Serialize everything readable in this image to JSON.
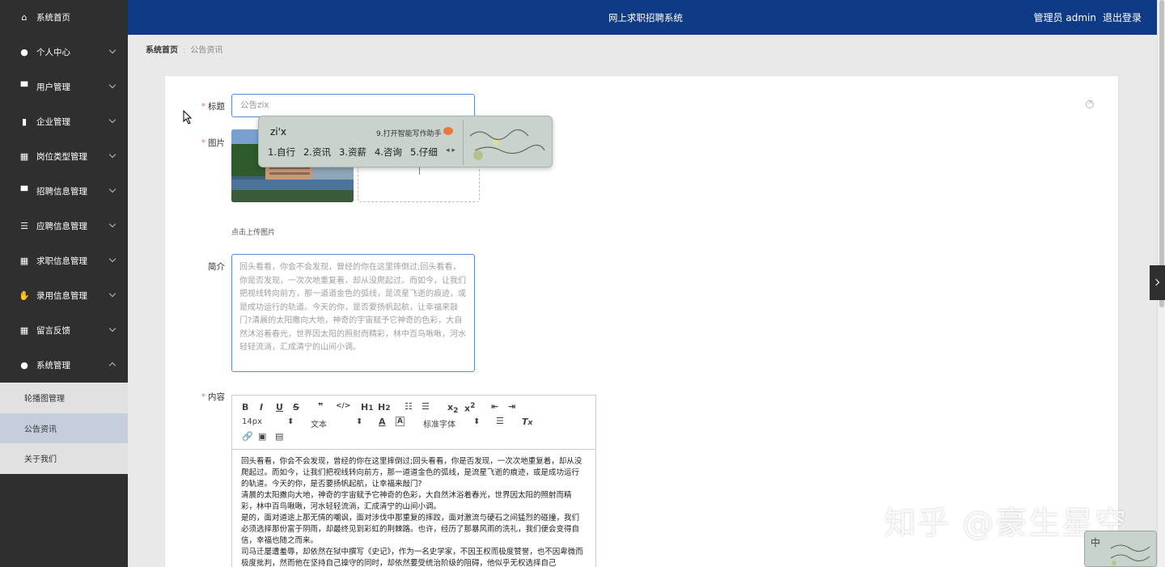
{
  "header": {
    "title": "网上求职招聘系统",
    "user": "管理员 admin",
    "logout": "退出登录"
  },
  "sidebar": {
    "items": [
      {
        "label": "系统首页",
        "icon": "home-icon",
        "has_arrow": false
      },
      {
        "label": "个人中心",
        "icon": "user-icon",
        "has_arrow": true
      },
      {
        "label": "用户管理",
        "icon": "monitor-icon",
        "has_arrow": true
      },
      {
        "label": "企业管理",
        "icon": "bar-chart-icon",
        "has_arrow": true
      },
      {
        "label": "岗位类型管理",
        "icon": "grid-icon",
        "has_arrow": true
      },
      {
        "label": "招聘信息管理",
        "icon": "monitor-icon",
        "has_arrow": true
      },
      {
        "label": "应聘信息管理",
        "icon": "sliders-icon",
        "has_arrow": true
      },
      {
        "label": "求职信息管理",
        "icon": "grid-icon",
        "has_arrow": true
      },
      {
        "label": "录用信息管理",
        "icon": "thumb-up-icon",
        "has_arrow": true
      },
      {
        "label": "留言反馈",
        "icon": "grid-icon",
        "has_arrow": true
      },
      {
        "label": "系统管理",
        "icon": "bulb-icon",
        "has_arrow": true,
        "expanded": true
      }
    ],
    "submenu": [
      {
        "label": "轮播图管理"
      },
      {
        "label": "公告资讯",
        "active": true
      },
      {
        "label": "关于我们"
      }
    ]
  },
  "breadcrumb": {
    "home": "系统首页",
    "current": "公告资讯"
  },
  "form": {
    "title_label": "标题",
    "title_value": "公告zix",
    "image_label": "图片",
    "upload_tip": "点击上传图片",
    "intro_label": "简介",
    "intro_text": "回头看看，你会不会发现，曾经的你在这里摔倒过;回头看看，你是否发现，一次次地重复着，却从没爬起过。而如今，让我们把视线转向前方，那一道道金色的弧线，是流星飞逝的痕迹，或是成功运行的轨道。今天的你，是否要扬帆起航，让幸福来敲门?清晨的太阳撒向大地，神奇的宇宙赋予它神奇的色彩，大自然沐浴着春光，世界因太阳的照射而精彩，林中百鸟啾啾，河水轻轻流淌，汇成清宁的山间小调。",
    "content_label": "内容",
    "editor": {
      "font_size": "14px",
      "block_type": "文本",
      "font_family": "标准字体",
      "content_lines": [
        "回头看看，你会不会发现，曾经的你在这里摔倒过;回头看看，你是否发现，一次次地重复着，却从没爬起过。而如今，让我们把视线转向前方，那一道道金色的弧线，是流星飞逝的痕迹，或是成功运行的轨道。今天的你，是否要扬帆起航，让幸福来敲门?",
        "清晨的太阳撒向大地，神奇的宇宙赋予它神奇的色彩，大自然沐浴着春光，世界因太阳的照射而精彩，林中百鸟啾啾，河水轻轻流淌，汇成清宁的山间小调。",
        "是的，面对道途上那无情的嘲讽，面对涉伐中那重复的摔跤，面对激流与硬石之间猛烈的碰撞，我们必须选择那份富于阴雨，却最终见到彩虹的荆棘路。也许，经历了那暴风雨的洗礼，我们便会变得自信，幸福也随之而来。",
        "司马迁屡遭羞辱，却依然在狱中撰写《史记》，作为一名史学家，不因王权而极度赞誉，也不因卑微而极度批判，然而他在坚持自己操守的同时，却依然要受统治阶级的阻碍，他似乎无权选择自己"
      ]
    }
  },
  "ime": {
    "composition": "zi'x",
    "hint": "9.打开智能写作助手",
    "candidates": [
      "1.自行",
      "2.资讯",
      "3.资薪",
      "4.咨询",
      "5.仔细"
    ]
  },
  "watermark": "知乎 @豪生星空",
  "corner_indicator": "中"
}
